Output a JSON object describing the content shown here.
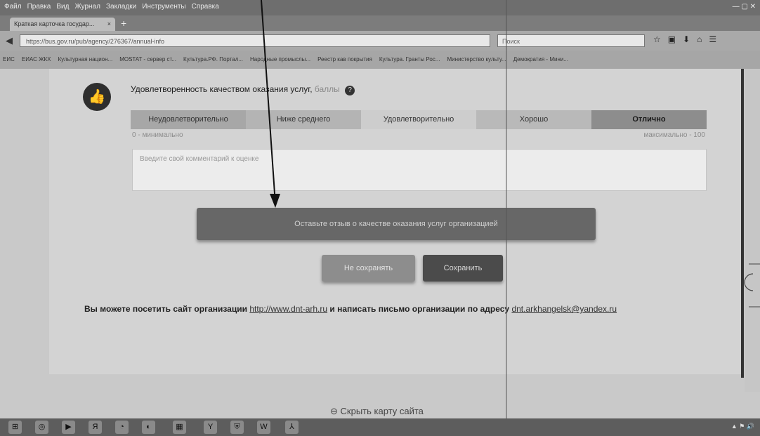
{
  "browser": {
    "menu": [
      "Файл",
      "Правка",
      "Вид",
      "Журнал",
      "Закладки",
      "Инструменты",
      "Справка"
    ],
    "tab_title": "Краткая карточка государ...",
    "tab_close": "×",
    "new_tab": "+",
    "url": "https://bus.gov.ru/pub/agency/276367/annual-info",
    "search_placeholder": "Поиск",
    "bookmarks": [
      "ЕИС",
      "ЕИАС ЖКХ",
      "Культурная национ...",
      "MOSTAT - сервер ст...",
      "Культура.РФ. Портал...",
      "Народные промыслы...",
      "Реестр кав покрытия",
      "Культура. Гранты Рос...",
      "Министерство культу...",
      "Демократия - Мини..."
    ]
  },
  "rating": {
    "question": "Удовлетворенность качеством оказания услуг,",
    "unit": "баллы",
    "help": "?",
    "levels": [
      "Неудовлетворительно",
      "Ниже среднего",
      "Удовлетворительно",
      "Хорошо",
      "Отлично"
    ],
    "selected": "Отлично",
    "min_label": "0 - минимально",
    "max_label": "максимально - 100"
  },
  "comment": {
    "placeholder": "Введите свой комментарий к оценке",
    "value": ""
  },
  "buttons": {
    "review": "Оставьте отзыв о качестве оказания услуг организацией",
    "no_save": "Не сохранять",
    "save": "Сохранить"
  },
  "visit": {
    "prefix": "Вы можете посетить сайт организации",
    "site": "http://www.dnt-arh.ru",
    "middle": "и написать письмо организации по адресу",
    "email": "dnt.arkhangelsk@yandex.ru"
  },
  "hide_map": "Скрыть карту сайта",
  "taskbar": {
    "items": [
      "Я",
      "W"
    ]
  },
  "colors": {
    "selected_segment": "#8d8d8d",
    "review_button": "#676767",
    "save_button": "#4b4b4b"
  }
}
